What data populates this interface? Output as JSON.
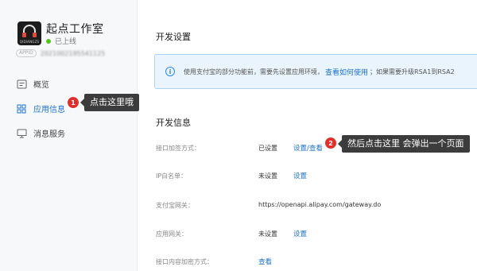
{
  "app": {
    "name": "起点工作室",
    "status": "已上线",
    "appid_tag": "APPID",
    "appid_value": "2021002195541125",
    "logo_text": "QIDIANGZS",
    "status_color": "#52c41a"
  },
  "nav": {
    "items": [
      {
        "label": "概览",
        "icon": "overview-icon"
      },
      {
        "label": "应用信息",
        "icon": "grid-icon"
      },
      {
        "label": "消息服务",
        "icon": "monitor-icon"
      }
    ]
  },
  "annotations": {
    "step1_number": "1",
    "step1_text": "点击这里哦",
    "step2_number": "2",
    "step2_text": "然后点击这里 会弹出一个页面"
  },
  "main": {
    "dev_settings_title": "开发设置",
    "notice": {
      "text": "使用支付宝的部分功能前，需要先设置应用环境，",
      "link": "查看如何使用",
      "text2": "；如果需要升级RSA1到RSA2"
    },
    "dev_info_title": "开发信息",
    "rows": [
      {
        "label": "接口加签方式：",
        "value": "已设置",
        "link": "设置/查看"
      },
      {
        "label": "IP白名单：",
        "value": "未设置",
        "link": "设置"
      },
      {
        "label": "支付宝网关：",
        "value": "https://openapi.alipay.com/gateway.do",
        "link": ""
      },
      {
        "label": "应用网关：",
        "value": "未设置",
        "link": "设置"
      },
      {
        "label": "接口内容加密方式：",
        "value": "",
        "link": "查看"
      }
    ]
  },
  "colors": {
    "accent": "#1b72c9",
    "badge": "#e0302d",
    "tooltip_bg": "#3c3c3c",
    "notice_bg": "#eaf4fd"
  }
}
